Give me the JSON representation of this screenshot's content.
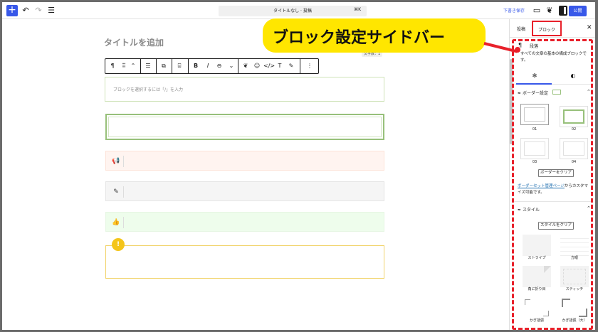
{
  "topbar": {
    "document_title": "タイトルなし · 投稿",
    "search_shortcut": "⌘K",
    "save_draft": "下書き保存",
    "publish": "公開"
  },
  "editor": {
    "post_title_placeholder": "タイトルを追加",
    "char_count": "文字数：1",
    "paragraph_placeholder": "ブロックを選択するには「/」を入力"
  },
  "callout": {
    "label": "ブロック設定サイドバー"
  },
  "sidebar": {
    "tabs": [
      "投稿",
      "ブロック"
    ],
    "block_name": "段落",
    "block_description": "すべての文章の基本の構成ブロックです。",
    "border_section": {
      "title": "ボーダー設定",
      "presets": [
        "01",
        "02",
        "03",
        "04"
      ],
      "clear_button": "ボーダーをクリア",
      "link_text": "ボーダーセット管理ページ",
      "link_suffix": "からカスタマイズ可能です。"
    },
    "style_section": {
      "title": "スタイル",
      "clear_button": "スタイルをクリア",
      "presets": [
        "ストライプ",
        "方眼",
        "角に折り目",
        "スティッチ",
        "かぎ括弧",
        "かぎ括弧（大）"
      ]
    }
  },
  "colors": {
    "accent_blue": "#3858e9",
    "highlight_red": "#e8212b",
    "callout_yellow": "#ffe600"
  }
}
